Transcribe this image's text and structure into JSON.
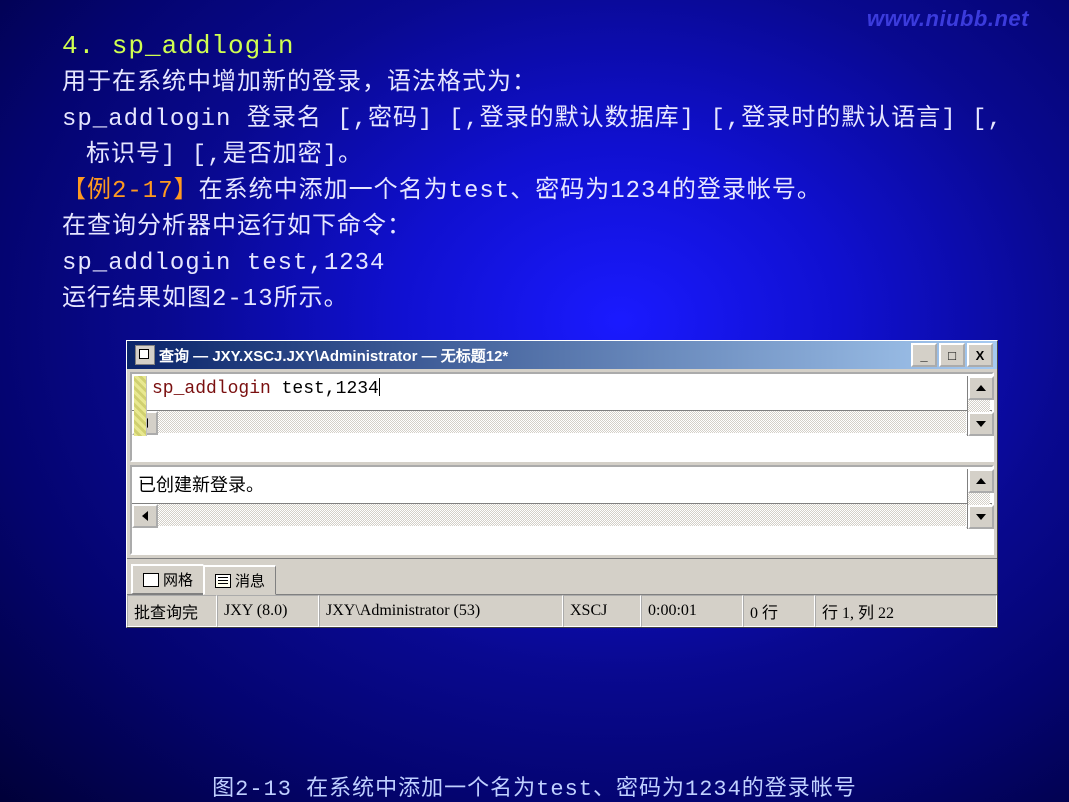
{
  "watermark": "www.niubb.net",
  "heading": "4. sp_addlogin",
  "body_text_1": "用于在系统中增加新的登录，语法格式为：",
  "body_text_2": "sp_addlogin 登录名 [,密码] [,登录的默认数据库] [,登录时的默认语言] [,标识号] [,是否加密]。",
  "example_label": "【例2-17】",
  "example_text": "在系统中添加一个名为test、密码为1234的登录帐号。",
  "body_text_3": "在查询分析器中运行如下命令：",
  "code_line": "sp_addlogin test,1234",
  "body_text_4": "运行结果如图2-13所示。",
  "caption": "图2-13  在系统中添加一个名为test、密码为1234的登录帐号",
  "window": {
    "title": "查询 — JXY.XSCJ.JXY\\Administrator — 无标题12*",
    "sql_keyword": "sp_addlogin",
    "sql_rest": " test,1234",
    "message": "已创建新登录。",
    "tabs": {
      "grid": "网格",
      "messages": "消息"
    },
    "status": {
      "c1": "批查询完",
      "c2": "JXY (8.0)",
      "c3": "JXY\\Administrator (53)",
      "c4": "XSCJ",
      "c5": "0:00:01",
      "c6": "0 行",
      "c7": "行 1, 列 22"
    }
  }
}
